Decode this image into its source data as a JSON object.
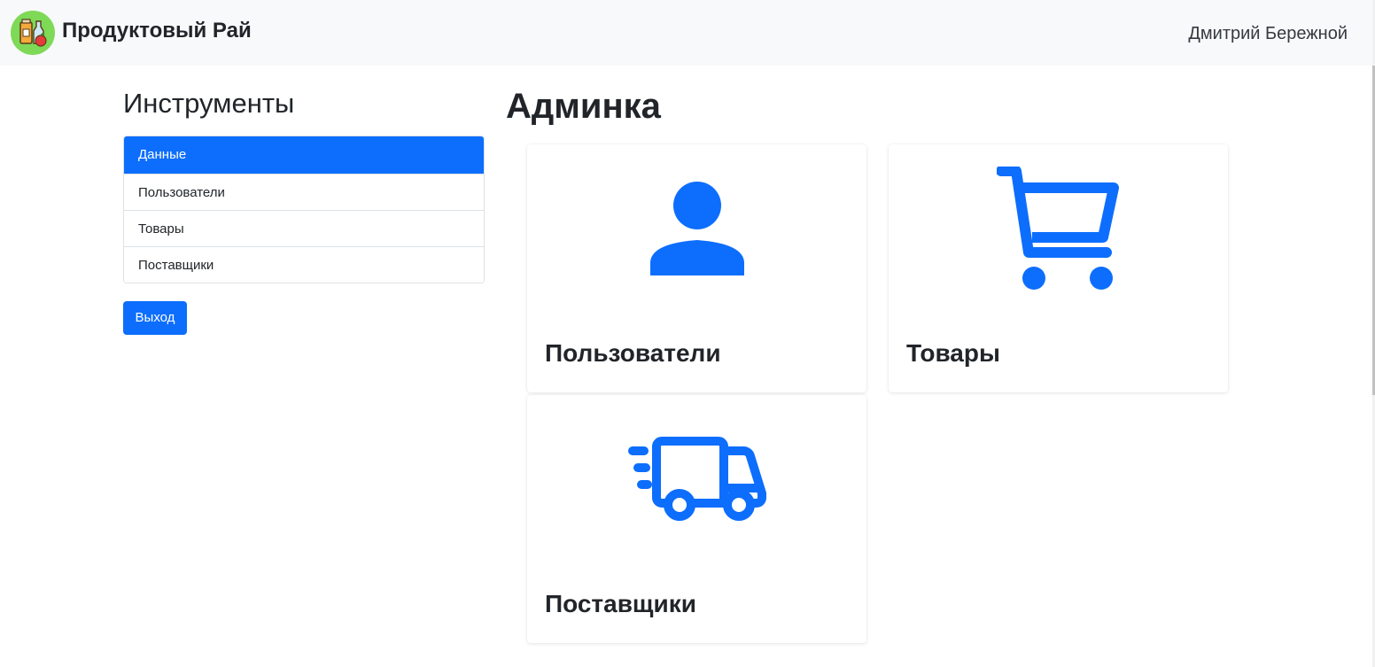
{
  "navbar": {
    "brand": "Продуктовый Рай",
    "user": "Дмитрий Бережной",
    "brand_logo_icon": "grocery-logo-icon"
  },
  "sidebar": {
    "title": "Инструменты",
    "items": [
      {
        "label": "Данные",
        "active": true
      },
      {
        "label": "Пользователи",
        "active": false
      },
      {
        "label": "Товары",
        "active": false
      },
      {
        "label": "Поставщики",
        "active": false
      }
    ],
    "exit_label": "Выход"
  },
  "main": {
    "title": "Админка",
    "cards": [
      {
        "title": "Пользователи",
        "icon": "person-icon"
      },
      {
        "title": "Товары",
        "icon": "cart-icon"
      },
      {
        "title": "Поставщики",
        "icon": "truck-icon"
      }
    ]
  },
  "colors": {
    "accent": "#0d6efd",
    "navbar_bg": "#f8f9fa",
    "logo_bg": "#7ed957"
  }
}
